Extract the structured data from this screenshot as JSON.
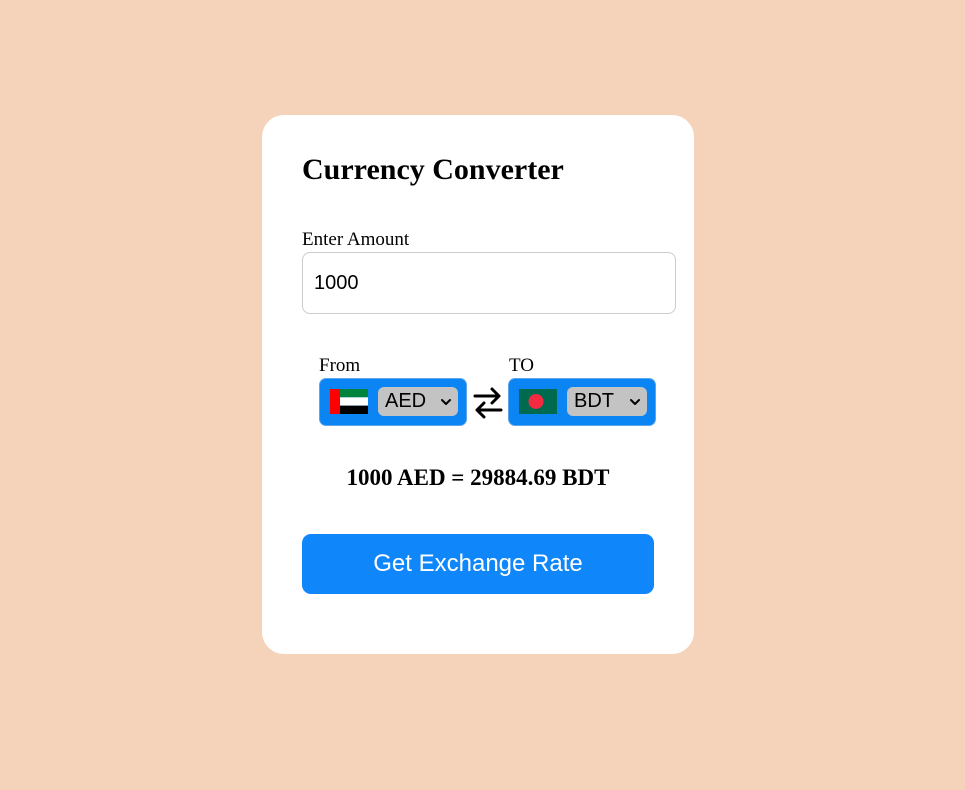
{
  "converter": {
    "title": "Currency Converter",
    "amount_label": "Enter Amount",
    "amount_value": "1000",
    "from": {
      "label": "From",
      "currency": "AED",
      "flag": "uae-flag-icon"
    },
    "to": {
      "label": "TO",
      "currency": "BDT",
      "flag": "bangladesh-flag-icon"
    },
    "swap_icon": "swap-arrows-icon",
    "result_text": "1000 AED = 29884.69 BDT",
    "button_label": "Get Exchange Rate"
  },
  "colors": {
    "background": "#f5d3bb",
    "card": "#ffffff",
    "selector_bg": "#0b84f4",
    "select_bg": "#c3c3c3",
    "button_bg": "#0f87fb",
    "button_text": "#ffffff"
  }
}
